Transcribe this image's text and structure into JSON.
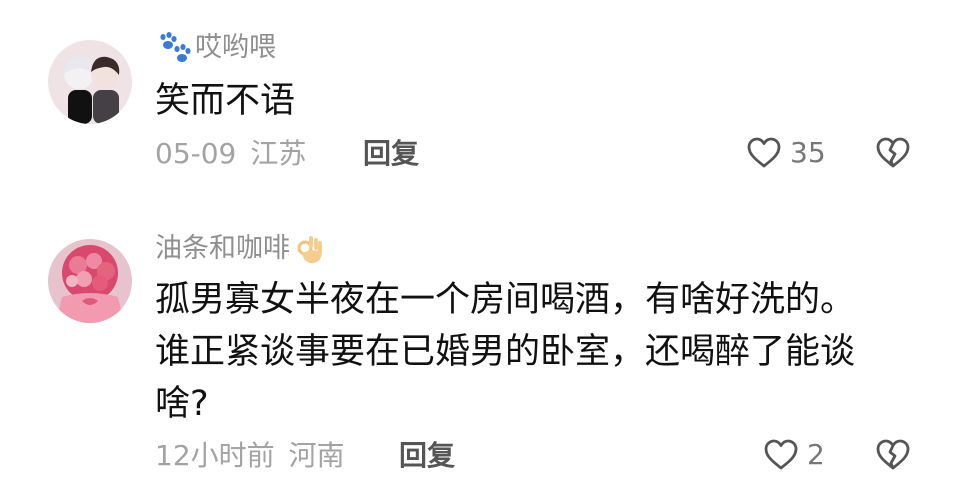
{
  "comments": [
    {
      "username": "哎哟喂",
      "text": "笑而不语",
      "time": "05-09",
      "region": "江苏",
      "reply_label": "回复",
      "like_count": "35"
    },
    {
      "username": "油条和咖啡",
      "text": "孤男寡女半夜在一个房间喝酒，有啥好洗的。\n谁正紧谈事要在已婚男的卧室，还喝醉了能谈\n啥?",
      "time": "12小时前",
      "region": "河南",
      "reply_label": "回复",
      "like_count": "2"
    }
  ],
  "colors": {
    "text": "#111111",
    "username": "#8f8f8f",
    "meta": "#a3a3a3",
    "icon": "#555555"
  },
  "icons": [
    "paw-prints-icon",
    "ok-hand-icon",
    "heart-outline-icon",
    "broken-heart-icon"
  ]
}
